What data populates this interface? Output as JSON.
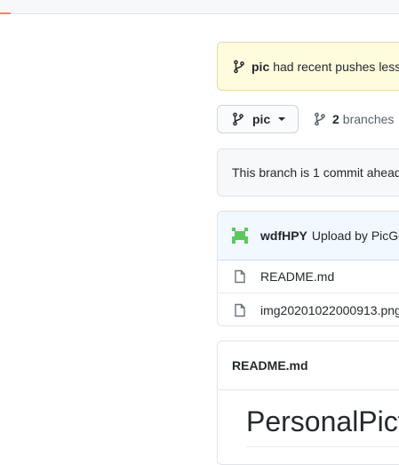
{
  "alert": {
    "branch": "pic",
    "text": "had recent pushes less t"
  },
  "branch_selector": {
    "current": "pic"
  },
  "branches": {
    "count": "2",
    "label": "branches"
  },
  "ahead_notice": "This branch is 1 commit ahead",
  "latest_commit": {
    "author": "wdfHPY",
    "message": "Upload by PicGo"
  },
  "files": [
    {
      "name": "README.md",
      "icon": "file-icon"
    },
    {
      "name": "img20201022000913.png",
      "icon": "file-icon"
    }
  ],
  "readme": {
    "filename": "README.md",
    "heading": "PersonalPict"
  },
  "colors": {
    "alert_bg": "#fffbdd",
    "commit_bg": "#f1f8ff",
    "avatar": "#5ec65e",
    "accent": "#f9826c"
  }
}
